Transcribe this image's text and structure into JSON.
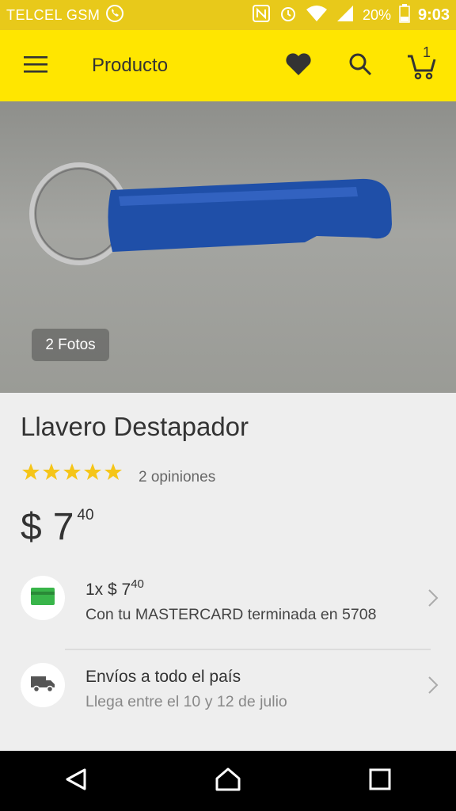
{
  "status_bar": {
    "carrier": "TELCEL GSM",
    "battery": "20%",
    "time": "9:03",
    "icons": [
      "whatsapp-icon",
      "nfc-icon",
      "alarm-icon",
      "wifi-icon",
      "signal-icon",
      "battery-icon"
    ]
  },
  "header": {
    "title": "Producto",
    "cart_count": "1",
    "icons": [
      "menu-icon",
      "heart-icon",
      "search-icon",
      "cart-icon"
    ]
  },
  "gallery": {
    "photo_count_label": "2 Fotos"
  },
  "product": {
    "title": "Llavero Destapador",
    "rating": 5,
    "reviews_label": "2 opiniones",
    "currency": "$",
    "price_int": "7",
    "price_cents": "40"
  },
  "payment": {
    "prefix": "1x $ 7",
    "cents": "40",
    "detail": "Con tu MASTERCARD terminada en 5708"
  },
  "shipping": {
    "title": "Envíos a todo el país",
    "detail": "Llega entre el 10 y 12 de julio"
  },
  "colors": {
    "appbar": "#ffe600",
    "statusbar": "#e8c91a",
    "star": "#f5c518",
    "card_green": "#39b54a"
  }
}
